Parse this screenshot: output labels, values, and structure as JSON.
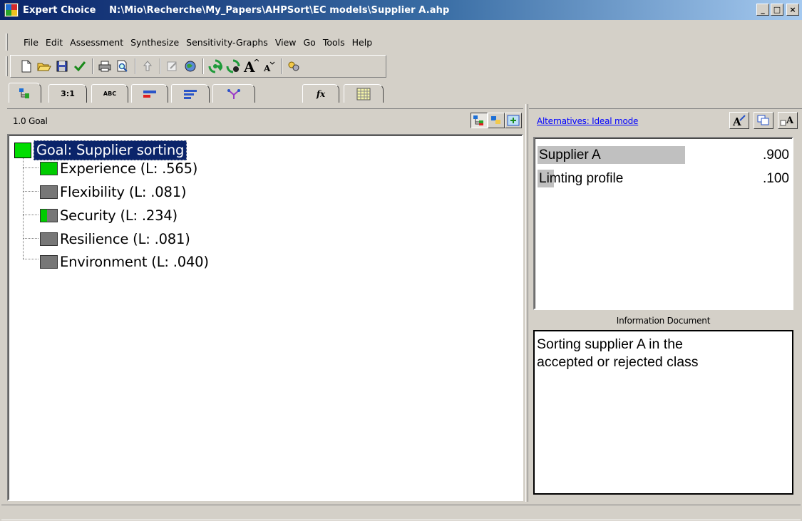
{
  "window": {
    "app_name": "Expert Choice",
    "file_path": "N:\\Mio\\Recherche\\My_Papers\\AHPSort\\EC models\\Supplier A.ahp",
    "controls": {
      "minimize": "_",
      "maximize": "□",
      "close": "×"
    }
  },
  "menu": [
    "File",
    "Edit",
    "Assessment",
    "Synthesize",
    "Sensitivity-Graphs",
    "View",
    "Go",
    "Tools",
    "Help"
  ],
  "toolbar_icons": [
    "new-file-icon",
    "open-folder-icon",
    "save-icon",
    "checkmark-icon",
    "print-icon",
    "print-preview-icon",
    "move-up-icon",
    "edit-icon",
    "globe-icon",
    "synthesize-icon",
    "synthesize-check-icon",
    "font-increase-icon",
    "font-decrease-icon",
    "options-icon"
  ],
  "view_tabs": [
    {
      "id": "tree-view",
      "label": "",
      "icon": "hierarchy-icon"
    },
    {
      "id": "pairwise-numerical",
      "label": "3:1"
    },
    {
      "id": "pairwise-verbal",
      "label": "ABC"
    },
    {
      "id": "graphical",
      "label": "",
      "icon": "bar-icon"
    },
    {
      "id": "data-grid",
      "label": "",
      "icon": "lines-icon"
    },
    {
      "id": "model-view",
      "label": "",
      "icon": "tree-icon"
    },
    {
      "id": "formula",
      "label": "fx"
    },
    {
      "id": "grid",
      "label": "",
      "icon": "grid-icon"
    }
  ],
  "left": {
    "node_path": "1.0 Goal",
    "goal": "Goal: Supplier sorting",
    "criteria": [
      {
        "label": "Experience (L: .565)",
        "local": 0.565
      },
      {
        "label": "Flexibility (L: .081)",
        "local": 0.081
      },
      {
        "label": "Security (L: .234)",
        "local": 0.234
      },
      {
        "label": "Resilience (L: .081)",
        "local": 0.081
      },
      {
        "label": "Environment (L: .040)",
        "local": 0.04
      }
    ]
  },
  "right": {
    "mode_link": "Alternatives: Ideal mode",
    "alternatives": [
      {
        "name": "Supplier A",
        "value": ".900",
        "priority": 0.9
      },
      {
        "name": "Limting profile",
        "value": ".100",
        "priority": 0.1
      }
    ],
    "info_label": "Information Document",
    "info_text": "Sorting supplier A in the\naccepted or rejected class"
  },
  "colors": {
    "title_start": "#0a246a",
    "goal_green": "#00dd00",
    "criterion_gray": "#777777",
    "priority_bar": "#c0c0c0",
    "link_blue": "#0000ff"
  }
}
